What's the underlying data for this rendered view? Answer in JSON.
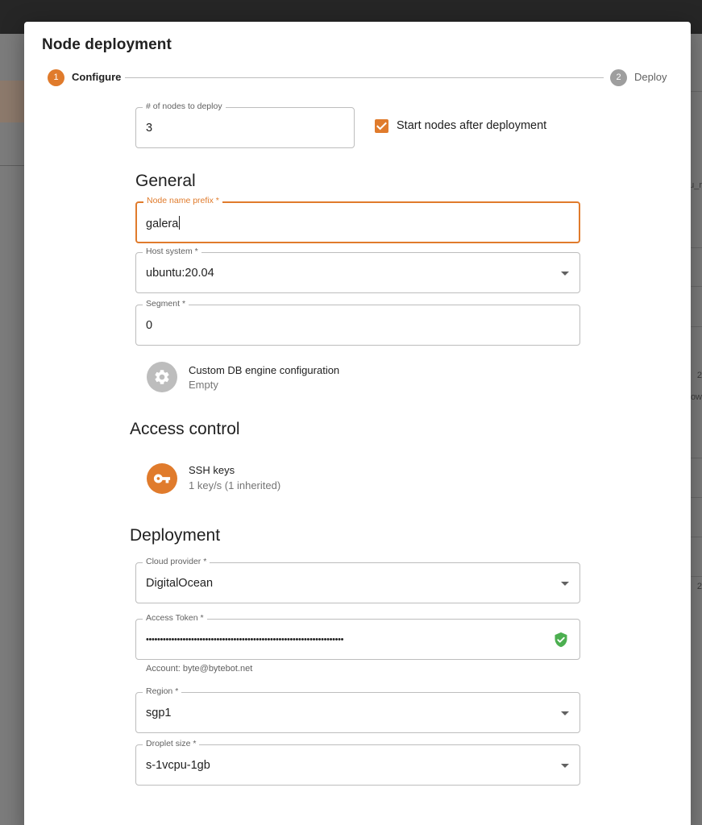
{
  "dialog": {
    "title": "Node deployment"
  },
  "stepper": {
    "steps": [
      {
        "number": "1",
        "label": "Configure",
        "active": true
      },
      {
        "number": "2",
        "label": "Deploy",
        "active": false
      }
    ]
  },
  "nodes": {
    "label": "# of nodes to deploy",
    "value": "3",
    "start_after_label": "Start nodes after deployment",
    "start_after_checked": true
  },
  "general": {
    "heading": "General",
    "name_prefix": {
      "label": "Node name prefix *",
      "value": "galera"
    },
    "host_system": {
      "label": "Host system *",
      "value": "ubuntu:20.04"
    },
    "segment": {
      "label": "Segment *",
      "value": "0"
    },
    "custom_engine": {
      "title": "Custom DB engine configuration",
      "subtitle": "Empty",
      "icon": "gear-icon"
    }
  },
  "access_control": {
    "heading": "Access control",
    "ssh_keys": {
      "title": "SSH keys",
      "subtitle": "1 key/s (1 inherited)",
      "icon": "key-icon"
    }
  },
  "deployment": {
    "heading": "Deployment",
    "cloud_provider": {
      "label": "Cloud provider *",
      "value": "DigitalOcean"
    },
    "access_token": {
      "label": "Access Token *",
      "masked_value": "••••••••••••••••••••••••••••••••••••••••••••••••••••••••••••••••••••••",
      "helper": "Account: byte@bytebot.net",
      "status_icon": "verified-shield-icon"
    },
    "region": {
      "label": "Region *",
      "value": "sgp1"
    },
    "droplet_size": {
      "label": "Droplet size *",
      "value": "s-1vcpu-1gb"
    }
  },
  "colors": {
    "accent": "#e07b2c",
    "inactive_step": "#9e9e9e",
    "verified": "#4caf50",
    "icon_disabled": "#bdbdbd"
  },
  "background": {
    "fragments": [
      "u_r",
      "2",
      "ow",
      "2"
    ]
  }
}
